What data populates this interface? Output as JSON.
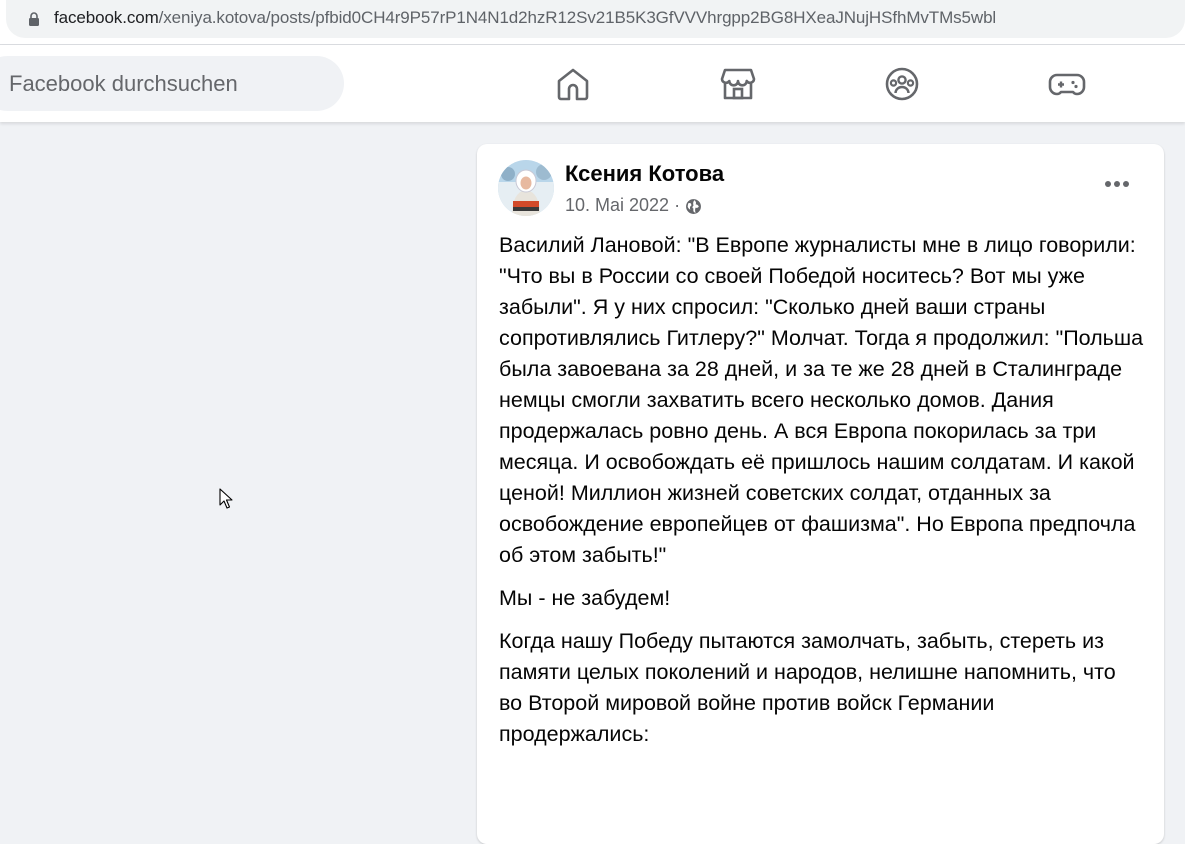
{
  "browser": {
    "url_domain": "facebook.com",
    "url_path": "/xeniya.kotova/posts/pfbid0CH4r9P57rP1N4N1d2hzR12Sv21B5K3GfVVVhrgpp2BG8HXeaJNujHSfhMvTMs5wbl"
  },
  "header": {
    "search_placeholder": "Facebook durchsuchen",
    "nav_icons": [
      "home-icon",
      "marketplace-icon",
      "groups-icon",
      "gaming-icon"
    ],
    "icon_color": "#65676b"
  },
  "post": {
    "author": "Ксения Котова",
    "date": "10. Mai 2022",
    "separator": "·",
    "privacy_icon": "globe-icon",
    "paragraphs": [
      "Василий Лановой: \"В Европе журналисты мне в лицо говорили: \"Что вы в России со своей Победой носитесь? Вот мы уже забыли\". Я у них спросил: \"Сколько дней ваши страны сопротивлялись Гитлеру?\" Молчат. Тогда я продолжил: \"Польша была завоевана за 28 дней, и за те же 28 дней в Сталинграде немцы смогли захватить всего несколько домов. Дания продержалась ровно день. А вся Европа покорилась за три месяца. И освобождать её пришлось нашим солдатам. И какой ценой! Миллион жизней советских солдат, отданных за освобождение европейцев от фашизма\". Но Европа предпочла об этом забыть!\"",
      "Мы - не забудем!",
      "Когда нашу Победу пытаются замолчать, забыть, стереть из памяти целых поколений и народов, нелишне напомнить, что во Второй мировой войне против войск Германии продержались:"
    ]
  },
  "colors": {
    "page_bg": "#f0f2f5",
    "card_bg": "#ffffff",
    "secondary_text": "#65676b"
  }
}
